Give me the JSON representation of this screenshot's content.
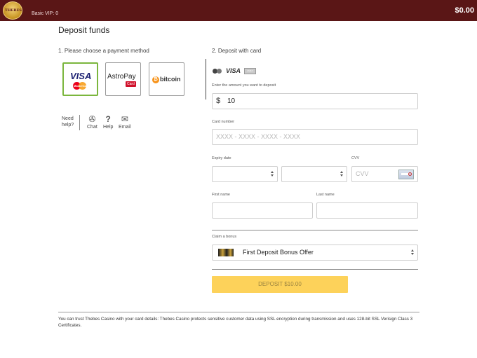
{
  "header": {
    "logo_icon": "thebes-casino-logo",
    "logo_text": "THEBES",
    "vip_label": "Basic VIP: 0",
    "balance": "$0.00",
    "bar_color": "#5a1616"
  },
  "page": {
    "title": "Deposit funds",
    "step1_label": "1. Please choose a payment method",
    "step2_label": "2. Deposit with card"
  },
  "payment_methods": [
    {
      "name": "VISA",
      "sub": "MasterCard",
      "selected": true
    },
    {
      "name": "AstroPay",
      "sub": "Card",
      "selected": false
    },
    {
      "name": "bitcoin",
      "icon": "bitcoin-icon",
      "selected": false
    }
  ],
  "help": {
    "label": "Need help?",
    "items": [
      {
        "label": "Chat",
        "icon": "chat-icon"
      },
      {
        "label": "Help",
        "icon": "question-icon"
      },
      {
        "label": "Email",
        "icon": "envelope-icon"
      }
    ]
  },
  "card_logos": {
    "visa": "VISA",
    "amex": "AMEX"
  },
  "form": {
    "amount_label": "Enter the amount you want to deposit",
    "currency_symbol": "$",
    "amount_value": "10",
    "card_number_label": "Card number",
    "card_number_placeholder": "XXXX - XXXX - XXXX - XXXX",
    "expiry_label": "Expiry date",
    "cvv_label": "CVV",
    "cvv_placeholder": "CVV",
    "first_name_label": "First name",
    "last_name_label": "Last name",
    "bonus_label": "Claim a bonus",
    "bonus_value": "First Deposit Bonus Offer",
    "deposit_button": "DEPOSIT $10.00",
    "button_color": "#fdd25a",
    "selected_border_color": "#7bb63d"
  },
  "footer": {
    "text": "You can trust Thebes Casino with your card details: Thebes Casino protects sensitive customer data using SSL encryption during transmission and uses 128-bit SSL Verisign Class 3 Certificates."
  }
}
